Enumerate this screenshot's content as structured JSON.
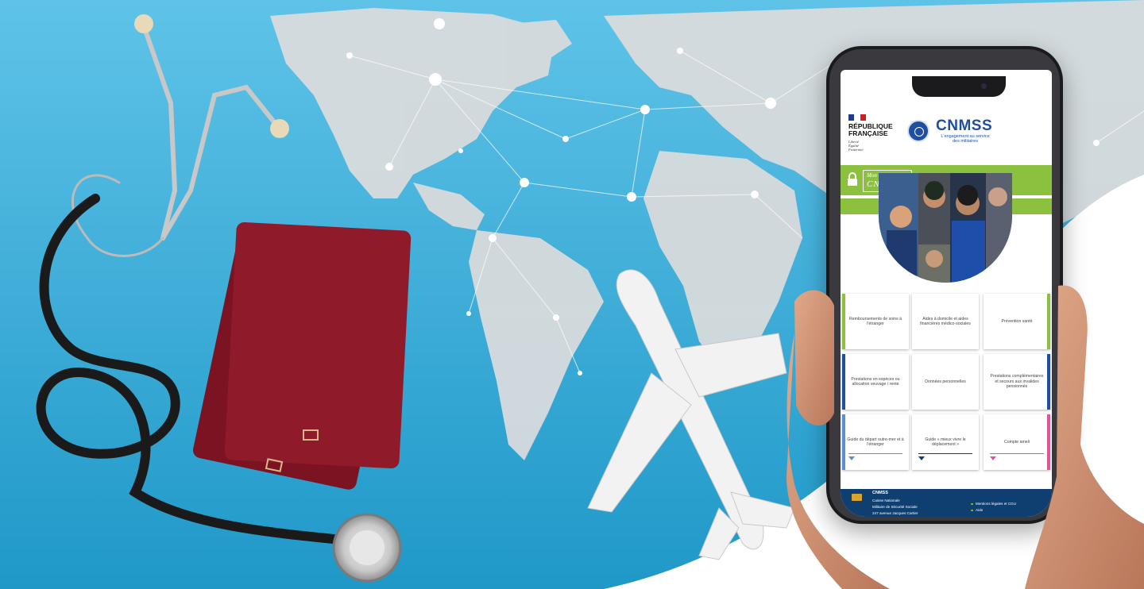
{
  "header": {
    "republic": "RÉPUBLIQUE\nFRANÇAISE",
    "motto": "Liberté\nÉgalité\nFraternité",
    "brand": "CNMSS",
    "tagline": "L'engagement au service des militaires"
  },
  "account": {
    "line1": "Mon compte",
    "line2": "CNMSS"
  },
  "tiles": [
    {
      "label": "Remboursements de soins à l'étranger",
      "accent": "#8cc13f"
    },
    {
      "label": "Aides à domicile et aides financières médico-sociales",
      "accent": null
    },
    {
      "label": "Prévention santé",
      "accent": "#8cc13f"
    },
    {
      "label": "Prestations en espèces ou allocation veuvage / rente",
      "accent": "#1e4fa0"
    },
    {
      "label": "Données personnelles",
      "accent": null
    },
    {
      "label": "Prestations complémentaires et secours aux invalides pensionnés",
      "accent": "#1e4fa0"
    },
    {
      "label": "Guide du départ outre-mer et à l'étranger",
      "accent": "#5b8fd4"
    },
    {
      "label": "Guide « mieux vivre le déplacement »",
      "accent": "#0f3f70"
    },
    {
      "label": "Compte ameli",
      "accent": "#e0559a"
    }
  ],
  "footer": {
    "title": "CNMSS",
    "lines": [
      "Caisse Nationale",
      "Militaire de Sécurité Sociale",
      "247 avenue Jacques Cartier"
    ],
    "links": [
      "Mentions légales et CGU",
      "Aide"
    ]
  },
  "colors": {
    "accent_green": "#8cc13f",
    "brand_blue": "#1e4fa0",
    "background": "#2ba3d0",
    "passport": "#8e1a2a"
  }
}
